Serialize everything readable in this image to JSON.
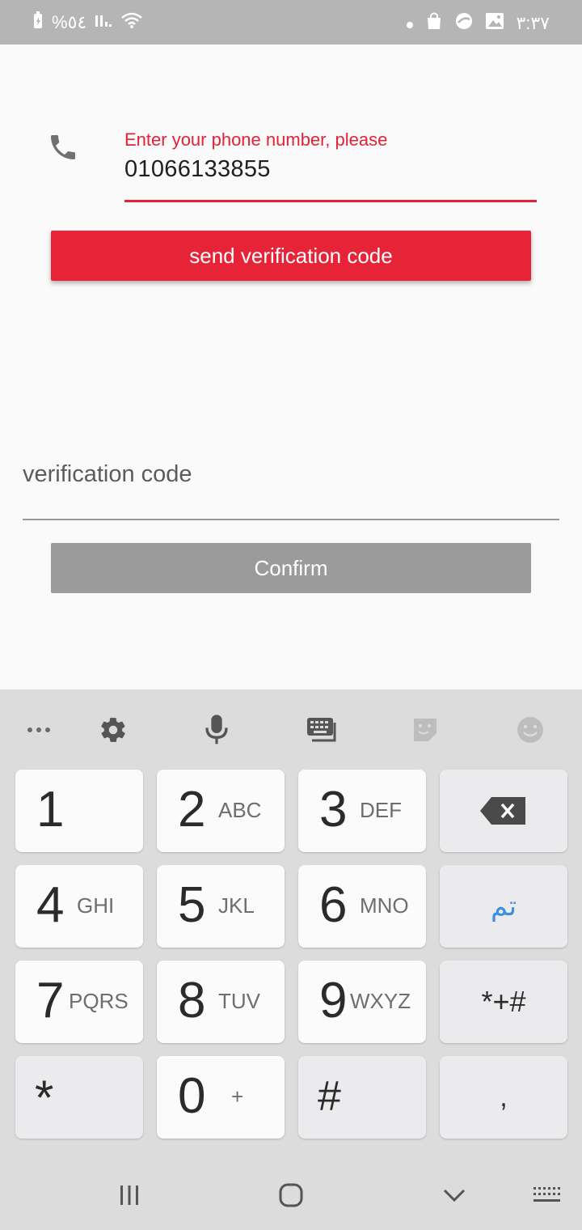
{
  "status_bar": {
    "battery_text": "%٥٤",
    "time": "٣:٣٧"
  },
  "phone": {
    "label": "Enter your phone number, please",
    "value": "01066133855",
    "icon": "phone-icon"
  },
  "send_button": {
    "label": "send verification code"
  },
  "verification": {
    "placeholder": "verification code"
  },
  "confirm_button": {
    "label": "Confirm"
  },
  "keyboard": {
    "toolbar": [
      "more-icon",
      "settings-icon",
      "microphone-icon",
      "keyboard-switch-icon",
      "sticker-icon",
      "emoji-icon"
    ],
    "keys": [
      {
        "num": "1",
        "letters": ""
      },
      {
        "num": "2",
        "letters": "ABC"
      },
      {
        "num": "3",
        "letters": "DEF"
      },
      {
        "num": "4",
        "letters": "GHI"
      },
      {
        "num": "5",
        "letters": "JKL"
      },
      {
        "num": "6",
        "letters": "MNO"
      },
      {
        "num": "7",
        "letters": "PQRS"
      },
      {
        "num": "8",
        "letters": "TUV"
      },
      {
        "num": "9",
        "letters": "WXYZ"
      },
      {
        "num": "0",
        "letters": "+"
      }
    ],
    "done_label": "تم",
    "symbols_label": "*+#",
    "star_label": "*",
    "hash_label": "#",
    "comma_label": ","
  },
  "colors": {
    "accent": "#e62337",
    "disabled": "#9b9b9b",
    "done_blue": "#3d8fe0"
  }
}
